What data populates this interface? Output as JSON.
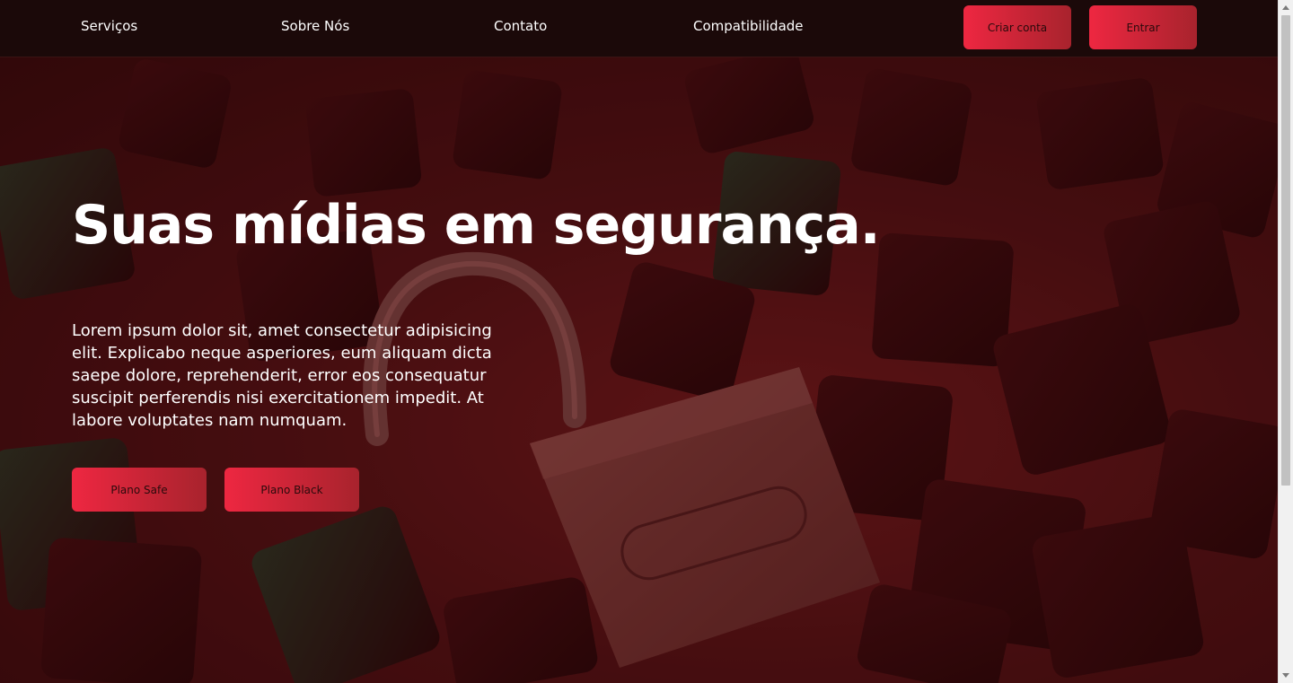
{
  "nav": {
    "links": [
      "Serviços",
      "Sobre Nós",
      "Contato",
      "Compatibilidade"
    ],
    "signup_label": "Criar conta",
    "login_label": "Entrar"
  },
  "hero": {
    "title": "Suas mídias em segurança.",
    "text": "Lorem ipsum dolor sit, amet consectetur adipisicing elit. Explicabo neque asperiores, eum aliquam dicta saepe dolore, reprehenderit, error eos consequatur suscipit perferendis nisi exercitationem impedit. At labore voluptates nam numquam.",
    "buttons": [
      "Plano Safe",
      "Plano Black"
    ],
    "background_image": "red-tinted keyboard keys with open padlock"
  },
  "colors": {
    "nav_background": "#1b0909",
    "button_gradient_start": "#ee2741",
    "button_gradient_end": "#a8232d",
    "text": "#ffffff"
  }
}
